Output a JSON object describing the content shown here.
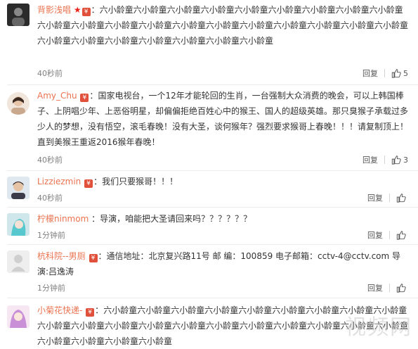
{
  "comments": [
    {
      "username": "背影浅唱",
      "text": "六小龄童六小龄童六小龄童六小龄童六小龄童六小龄童六小龄童六小龄童六小龄童六小龄童六小龄童六小龄童六小龄童六小龄童六小龄童六小龄童六小龄童六小龄童六小龄童六小龄童六小龄童六小龄童六小龄童六小龄童六小龄童六小龄童六小龄童",
      "time": "40秒前",
      "reply_label": "回复",
      "likes": "5"
    },
    {
      "username": "Amy_Chu",
      "text": "国家电视台，一个12年才能轮回的生肖，一台强制大众消费的晚会，可以上韩国棒子、上阴唱少年、上恶俗明星，却偏偏拒绝百姓心中的猴王、国人的超级英雄。那只臭猴子承载过多少人的梦想，没有悟空，滚毛春晚！没有大圣，谈何猴年？强烈要求猴哥上春晚！！！请复制顶上！直到美猴王重返2016猴年春晚！",
      "time": "40秒前",
      "reply_label": "回复",
      "likes": "3"
    },
    {
      "username": "Lizziezmin",
      "text": "我们只要猴哥！！！",
      "time": "40秒前",
      "reply_label": "回复",
      "likes": ""
    },
    {
      "username": "柠檬ninmom",
      "text": "导演，咱能把大圣请回来吗？？？？？？",
      "time": "1分钟前",
      "reply_label": "回复",
      "likes": ""
    },
    {
      "username": "杭科院--男厕",
      "text": "通信地址：北京复兴路11号 邮 编：100859 电子邮箱：cctv-4@cctv.com 导演:吕逸涛",
      "time": "1分钟前",
      "reply_label": "回复",
      "likes": ""
    },
    {
      "username": "小菊花快递-",
      "text": "六小龄童六小龄童六小龄童六小龄童六小龄童六小龄童六小龄童六小龄童六小龄童六小龄童六小龄童六小龄童六小龄童六小龄童六小龄童六小龄童六小龄童六小龄童六小龄童六小龄童六小龄童六小龄童六小龄童六小龄童",
      "time": "",
      "reply_label": "",
      "likes": ""
    }
  ],
  "badge_glyph": "¥",
  "star_glyph": "★",
  "colon": "：",
  "watermark": "视频网",
  "colors": {
    "username": "#eb7350",
    "meta": "#808080",
    "badge": "#e0503a"
  },
  "icons": {
    "like": "thumbs-up-icon",
    "member": "member-badge-icon",
    "star": "star-icon"
  }
}
